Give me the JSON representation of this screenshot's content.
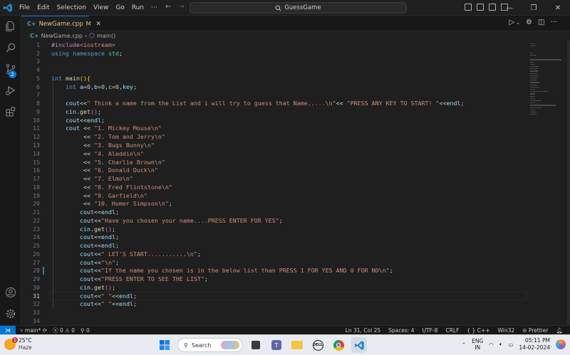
{
  "titlebar": {
    "menus": [
      "File",
      "Edit",
      "Selection",
      "View",
      "Go",
      "Run",
      "···"
    ],
    "search_text": "GuessGame"
  },
  "activitybar": {
    "scm_badge": "2"
  },
  "tab": {
    "filename": "NewGame.cpp",
    "modified_marker": "M"
  },
  "breadcrumb": {
    "file": "NewGame.cpp",
    "symbol": "main()"
  },
  "code_lines": [
    {
      "n": "1",
      "tokens": [
        [
          "pp",
          "#include"
        ],
        [
          "inc",
          "<iostream>"
        ]
      ]
    },
    {
      "n": "2",
      "tokens": [
        [
          "kw",
          "using"
        ],
        [
          "op",
          " "
        ],
        [
          "kw",
          "namespace"
        ],
        [
          "op",
          " "
        ],
        [
          "ns",
          "std"
        ],
        [
          "op",
          ";"
        ]
      ]
    },
    {
      "n": "3",
      "tokens": []
    },
    {
      "n": "4",
      "tokens": []
    },
    {
      "n": "5",
      "tokens": [
        [
          "kw",
          "int"
        ],
        [
          "op",
          " "
        ],
        [
          "fn",
          "main"
        ],
        [
          "br",
          "()"
        ],
        [
          "br",
          "{"
        ]
      ]
    },
    {
      "n": "6",
      "tokens": [
        [
          "op",
          "    "
        ],
        [
          "kw",
          "int"
        ],
        [
          "op",
          " "
        ],
        [
          "var",
          "a"
        ],
        [
          "op",
          "="
        ],
        [
          "num",
          "0"
        ],
        [
          "op",
          ","
        ],
        [
          "var",
          "b"
        ],
        [
          "op",
          "="
        ],
        [
          "num",
          "0"
        ],
        [
          "op",
          ","
        ],
        [
          "var",
          "c"
        ],
        [
          "op",
          "="
        ],
        [
          "num",
          "0"
        ],
        [
          "op",
          ","
        ],
        [
          "var",
          "key"
        ],
        [
          "op",
          ";"
        ]
      ]
    },
    {
      "n": "7",
      "tokens": []
    },
    {
      "n": "8",
      "tokens": [
        [
          "op",
          "    "
        ],
        [
          "var",
          "cout"
        ],
        [
          "op",
          "<<"
        ],
        [
          "str",
          "\" Think a name from the List and i will try to guess that Name.....\\n\""
        ],
        [
          "op",
          "<< "
        ],
        [
          "str",
          "\"PRESS ANY KEY TO START! \""
        ],
        [
          "op",
          "<<"
        ],
        [
          "var",
          "endl"
        ],
        [
          "op",
          ";"
        ]
      ]
    },
    {
      "n": "9",
      "tokens": [
        [
          "op",
          "    "
        ],
        [
          "var",
          "cin"
        ],
        [
          "op",
          "."
        ],
        [
          "fn",
          "get"
        ],
        [
          "br2",
          "()"
        ],
        [
          "op",
          ";"
        ]
      ]
    },
    {
      "n": "10",
      "tokens": [
        [
          "op",
          "    "
        ],
        [
          "var",
          "cout"
        ],
        [
          "op",
          "<<"
        ],
        [
          "var",
          "endl"
        ],
        [
          "op",
          ";"
        ]
      ]
    },
    {
      "n": "11",
      "tokens": [
        [
          "op",
          "    "
        ],
        [
          "var",
          "cout"
        ],
        [
          "op",
          " << "
        ],
        [
          "str",
          "\"1. Mickey Mouse\\n\""
        ]
      ]
    },
    {
      "n": "12",
      "tokens": [
        [
          "op",
          "         << "
        ],
        [
          "str",
          "\"2. Tom and Jerry\\n\""
        ]
      ]
    },
    {
      "n": "13",
      "tokens": [
        [
          "op",
          "         << "
        ],
        [
          "str",
          "\"3. Bugs Bunny\\n\""
        ]
      ]
    },
    {
      "n": "14",
      "tokens": [
        [
          "op",
          "         << "
        ],
        [
          "str",
          "\"4. Aleddin\\n\""
        ]
      ]
    },
    {
      "n": "15",
      "tokens": [
        [
          "op",
          "         << "
        ],
        [
          "str",
          "\"5. Charlie Brown\\n\""
        ]
      ]
    },
    {
      "n": "16",
      "tokens": [
        [
          "op",
          "         << "
        ],
        [
          "str",
          "\"6. Donald Duck\\n\""
        ]
      ]
    },
    {
      "n": "17",
      "tokens": [
        [
          "op",
          "         << "
        ],
        [
          "str",
          "\"7. Elmo\\n\""
        ]
      ]
    },
    {
      "n": "18",
      "tokens": [
        [
          "op",
          "         << "
        ],
        [
          "str",
          "\"8. Fred Flintstone\\n\""
        ]
      ]
    },
    {
      "n": "19",
      "tokens": [
        [
          "op",
          "         << "
        ],
        [
          "str",
          "\"9. Garfield\\n\""
        ]
      ]
    },
    {
      "n": "20",
      "tokens": [
        [
          "op",
          "         << "
        ],
        [
          "str",
          "\"10. Homer Simpson\\n\""
        ],
        [
          "op",
          ";"
        ]
      ]
    },
    {
      "n": "21",
      "tokens": [
        [
          "op",
          "        "
        ],
        [
          "var",
          "cout"
        ],
        [
          "op",
          "<<"
        ],
        [
          "var",
          "endl"
        ],
        [
          "op",
          ";"
        ]
      ]
    },
    {
      "n": "22",
      "tokens": [
        [
          "op",
          "        "
        ],
        [
          "var",
          "cout"
        ],
        [
          "op",
          "<<"
        ],
        [
          "str",
          "\"Have you chosen your name....PRESS ENTER FOR YES\""
        ],
        [
          "op",
          ";"
        ]
      ]
    },
    {
      "n": "23",
      "tokens": [
        [
          "op",
          "        "
        ],
        [
          "var",
          "cin"
        ],
        [
          "op",
          "."
        ],
        [
          "fn",
          "get"
        ],
        [
          "br2",
          "()"
        ],
        [
          "op",
          ";"
        ]
      ]
    },
    {
      "n": "24",
      "tokens": [
        [
          "op",
          "        "
        ],
        [
          "var",
          "cout"
        ],
        [
          "op",
          "<<"
        ],
        [
          "var",
          "endl"
        ],
        [
          "op",
          ";"
        ]
      ]
    },
    {
      "n": "25",
      "tokens": [
        [
          "op",
          "        "
        ],
        [
          "var",
          "cout"
        ],
        [
          "op",
          "<<"
        ],
        [
          "var",
          "endl"
        ],
        [
          "op",
          ";"
        ]
      ]
    },
    {
      "n": "26",
      "tokens": [
        [
          "op",
          "        "
        ],
        [
          "var",
          "cout"
        ],
        [
          "op",
          "<<"
        ],
        [
          "str",
          "\" LET'S START...........\\n\""
        ],
        [
          "op",
          ";"
        ]
      ]
    },
    {
      "n": "27",
      "tokens": [
        [
          "op",
          "        "
        ],
        [
          "var",
          "cout"
        ],
        [
          "op",
          "<<"
        ],
        [
          "str",
          "\"\\n\""
        ],
        [
          "op",
          ";"
        ]
      ]
    },
    {
      "n": "28",
      "tokens": [
        [
          "op",
          "        "
        ],
        [
          "var",
          "cout"
        ],
        [
          "op",
          "<<"
        ],
        [
          "str",
          "\"If the name you chosen is in the below list than PRESS 1 FOR YES AND 0 FOR NO\\n\""
        ],
        [
          "op",
          ";"
        ]
      ]
    },
    {
      "n": "29",
      "tokens": [
        [
          "op",
          "        "
        ],
        [
          "var",
          "cout"
        ],
        [
          "op",
          "<<"
        ],
        [
          "str",
          "\"PRESS ENTER TO SEE THE LIST\""
        ],
        [
          "op",
          ";"
        ]
      ]
    },
    {
      "n": "30",
      "tokens": [
        [
          "op",
          "        "
        ],
        [
          "var",
          "cin"
        ],
        [
          "op",
          "."
        ],
        [
          "fn",
          "get"
        ],
        [
          "br2",
          "()"
        ],
        [
          "op",
          ";"
        ]
      ]
    },
    {
      "n": "31",
      "tokens": [
        [
          "op",
          "        "
        ],
        [
          "var",
          "cout"
        ],
        [
          "op",
          "<<"
        ],
        [
          "str",
          "\" \""
        ],
        [
          "op",
          "<<"
        ],
        [
          "var",
          "endl"
        ],
        [
          "op",
          ";"
        ]
      ]
    },
    {
      "n": "32",
      "tokens": [
        [
          "op",
          "        "
        ],
        [
          "var",
          "cout"
        ],
        [
          "op",
          "<<"
        ],
        [
          "str",
          "\" \""
        ],
        [
          "op",
          "<<"
        ],
        [
          "var",
          "endl"
        ],
        [
          "op",
          ";"
        ]
      ]
    },
    {
      "n": "33",
      "tokens": []
    },
    {
      "n": "34",
      "tokens": []
    }
  ],
  "statusbar": {
    "branch": "main*",
    "errors": "0",
    "warnings": "0",
    "ports": "0",
    "position": "Ln 31, Col 25",
    "spaces": "Spaces: 4",
    "encoding": "UTF-8",
    "eol": "CRLF",
    "language": "C++",
    "platform": "Win32",
    "formatter": "Prettier"
  },
  "taskbar": {
    "temperature": "25°C",
    "condition": "Haze",
    "weather_badge": "1",
    "search_label": "Search",
    "lang_top": "ENG",
    "lang_bottom": "IN",
    "time": "05:11 PM",
    "date": "14-02-2024"
  }
}
